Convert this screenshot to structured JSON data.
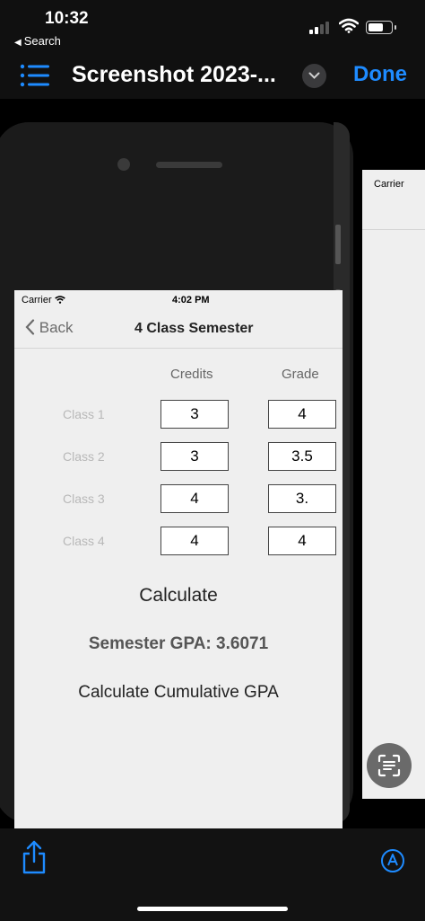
{
  "status_bar": {
    "time": "10:32",
    "back_app": "Search"
  },
  "viewer": {
    "title": "Screenshot 2023-...",
    "done_label": "Done"
  },
  "app": {
    "status": {
      "carrier": "Carrier",
      "time": "4:02 PM"
    },
    "nav": {
      "back_label": "Back",
      "title": "4 Class Semester"
    },
    "columns": {
      "credits": "Credits",
      "grade": "Grade"
    },
    "classes": [
      {
        "label": "Class 1",
        "credits": "3",
        "grade": "4"
      },
      {
        "label": "Class 2",
        "credits": "3",
        "grade": "3.5"
      },
      {
        "label": "Class 3",
        "credits": "4",
        "grade": "3."
      },
      {
        "label": "Class 4",
        "credits": "4",
        "grade": "4"
      }
    ],
    "calculate_label": "Calculate",
    "gpa_text": "Semester GPA: 3.6071",
    "cumulative_label": "Calculate Cumulative GPA"
  },
  "next_photo": {
    "carrier": "Carrier"
  },
  "icons": {
    "list": "list-icon",
    "chevron": "chevron-down-icon",
    "share": "share-icon",
    "markup": "markup-icon",
    "live_text": "live-text-icon",
    "wifi": "wifi-icon"
  },
  "colors": {
    "accent": "#1e8bff",
    "background": "#000000",
    "screen": "#efefef"
  }
}
